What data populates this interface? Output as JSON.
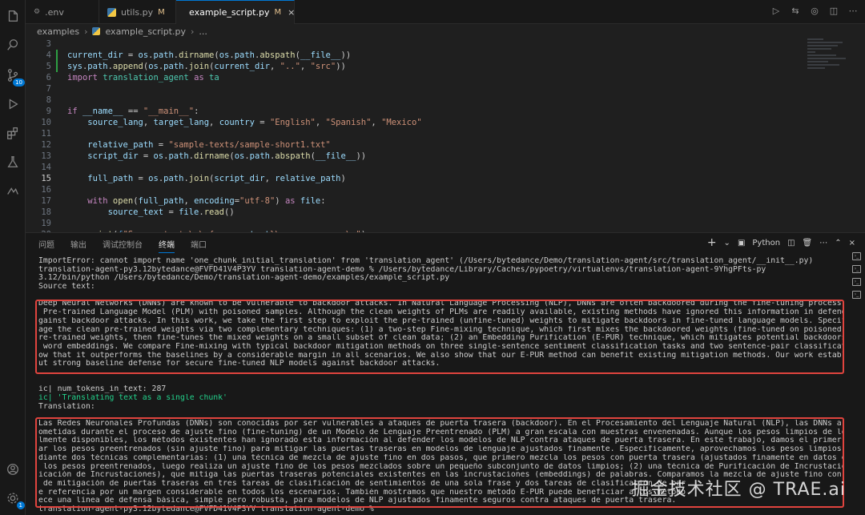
{
  "tabs": [
    {
      "label": ".env",
      "modified": ""
    },
    {
      "label": "utils.py",
      "modified": "M"
    },
    {
      "label": "example_script.py",
      "modified": "M"
    }
  ],
  "breadcrumb": {
    "folder": "examples",
    "file": "example_script.py",
    "more": "..."
  },
  "activity": {
    "scm_badge": "10",
    "account_badge": "1"
  },
  "editor": {
    "line_numbers": [
      "3",
      "4",
      "5",
      "6",
      "7",
      "8",
      "9",
      "10",
      "11",
      "12",
      "13",
      "14",
      "15",
      "16",
      "17",
      "18",
      "19",
      "20"
    ]
  },
  "panel": {
    "tabs": [
      "问题",
      "输出",
      "调试控制台",
      "终端",
      "端口"
    ],
    "active_tab": "终端",
    "shell": "Python"
  },
  "terminal": {
    "lines_top": [
      "ImportError: cannot import name 'one_chunk_initial_translation' from 'translation_agent' (/Users/bytedance/Demo/translation-agent/src/translation_agent/__init__.py)",
      "translation-agent-py3.12bytedance@FVFD41V4P3YV translation-agent-demo % /Users/bytedance/Library/Caches/pypoetry/virtualenvs/translation-agent-9YhgPFts-py",
      "3.12/bin/python /Users/bytedance/Demo/translation-agent-demo/examples/example_script.py",
      "Source text:"
    ],
    "source_block": [
      "Deep Neural Networks (DNNs) are known to be vulnerable to backdoor attacks. In Natural Language Processing (NLP), DNNs are often backdoored during the fine-tuning process of a large-scale",
      " Pre-trained Language Model (PLM) with poisoned samples. Although the clean weights of PLMs are readily available, existing methods have ignored this information in defending NLP models a",
      "gainst backdoor attacks. In this work, we take the first step to exploit the pre-trained (unfine-tuned) weights to mitigate backdoors in fine-tuned language models. Specifically, we lever",
      "age the clean pre-trained weights via two complementary techniques: (1) a two-step Fine-mixing technique, which first mixes the backdoored weights (fine-tuned on poisoned data) with the p",
      "re-trained weights, then fine-tunes the mixed weights on a small subset of clean data; (2) an Embedding Purification (E-PUR) technique, which mitigates potential backdoors existing in the",
      " word embeddings. We compare Fine-mixing with typical backdoor mitigation methods on three single-sentence sentiment classification tasks and two sentence-pair classification tasks and sh",
      "ow that it outperforms the baselines by a considerable margin in all scenarios. We also show that our E-PUR method can benefit existing mitigation methods. Our work establishes a simple b",
      "ut strong baseline defense for secure fine-tuned NLP models against backdoor attacks."
    ],
    "ic_lines": [
      "ic| num_tokens_in_text: 287",
      "ic| 'Translating text as a single chunk'",
      "Translation:"
    ],
    "translation_block": [
      "Las Redes Neuronales Profundas (DNNs) son conocidas por ser vulnerables a ataques de puerta trasera (backdoor). En el Procesamiento del Lenguaje Natural (NLP), las DNNs a menudo son compr",
      "ometidas durante el proceso de ajuste fino (fine-tuning) de un Modelo de Lenguaje Preentrenado (PLM) a gran escala con muestras envenenadas. Aunque los pesos limpios de los PLM están fáci",
      "lmente disponibles, los métodos existentes han ignorado esta información al defender los modelos de NLP contra ataques de puerta trasera. En este trabajo, damos el primer paso para explot",
      "ar los pesos preentrenados (sin ajuste fino) para mitigar las puertas traseras en modelos de lenguaje ajustados finamente. Específicamente, aprovechamos los pesos limpios preentrenados me",
      "diante dos técnicas complementarias: (1) una técnica de mezcla de ajuste fino en dos pasos, que primero mezcla los pesos con puerta trasera (ajustados finamente en datos envenenados) con",
      " los pesos preentrenados, luego realiza un ajuste fino de los pesos mezclados sobre un pequeño subconjunto de datos limpios; (2) una técnica de Purificación de Incrustaciones (E-PUR, Purif",
      "icación de Incrustaciones), que mitiga las puertas traseras potenciales existentes en las incrustaciones (embeddings) de palabras. Comparamos la mezcla de ajuste fino con métodos típicos",
      " de mitigación de puertas traseras en tres tareas de clasificación de sentimientos de una sola frase y dos tareas de clasificación de par",
      "e referencia por un margen considerable en todos los escenarios. También mostramos que nuestro método E-PUR puede beneficiar a los método",
      "ece una línea de defensa básica, simple pero robusta, para modelos de NLP ajustados finamente seguros contra ataques de puerta trasera."
    ],
    "prompt": "translation-agent-py3.12bytedance@FVFD41V4P3YV translation-agent-demo % "
  },
  "watermark": "掘金技术社区 @ TRAE.ai"
}
